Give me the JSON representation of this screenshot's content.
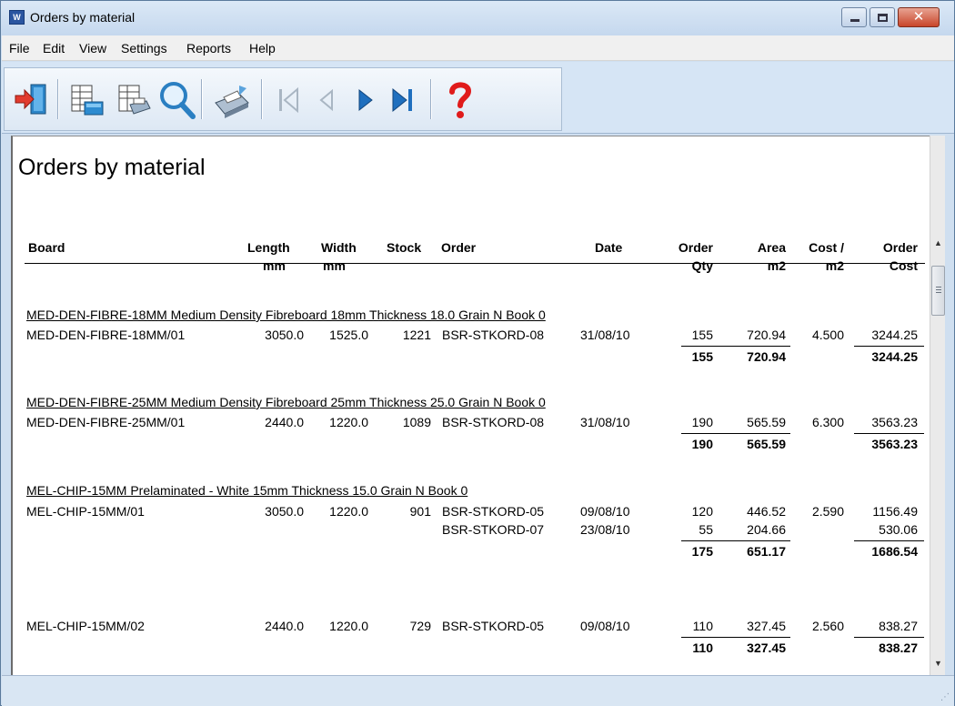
{
  "window": {
    "app_icon_text": "W",
    "title": "Orders by material",
    "close_glyph": "✕"
  },
  "menu": [
    "File",
    "Edit",
    "View",
    "Settings",
    "Reports",
    "Help"
  ],
  "toolbar": {
    "buttons": [
      "exit-icon",
      "board-list-icon",
      "print-list-icon",
      "search-icon",
      "printer-icon",
      "first-record-icon",
      "previous-record-icon",
      "next-record-icon",
      "last-record-icon",
      "help-icon"
    ]
  },
  "report": {
    "title": "Orders by material",
    "headers": {
      "board": "Board",
      "length": "Length",
      "length_unit": "mm",
      "width": "Width",
      "width_unit": "mm",
      "stock": "Stock",
      "order": "Order",
      "date": "Date",
      "order_qty_1": "Order",
      "order_qty_2": "Qty",
      "area_1": "Area",
      "area_2": "m2",
      "cost_1": "Cost /",
      "cost_2": "m2",
      "order_cost_1": "Order",
      "order_cost_2": "Cost"
    },
    "groups": [
      {
        "title": "MED-DEN-FIBRE-18MM Medium Density Fibreboard 18mm Thickness  18.0 Grain N Book 0",
        "rows": [
          {
            "board": "MED-DEN-FIBRE-18MM/01",
            "length": "3050.0",
            "width": "1525.0",
            "stock": "1221",
            "order": "BSR-STKORD-08",
            "date": "31/08/10",
            "qty": "155",
            "area": "720.94",
            "cost": "4.500",
            "order_cost": "3244.25"
          }
        ],
        "total": {
          "qty": "155",
          "area": "720.94",
          "order_cost": "3244.25"
        }
      },
      {
        "title": "MED-DEN-FIBRE-25MM Medium Density Fibreboard 25mm Thickness  25.0 Grain N Book 0",
        "rows": [
          {
            "board": "MED-DEN-FIBRE-25MM/01",
            "length": "2440.0",
            "width": "1220.0",
            "stock": "1089",
            "order": "BSR-STKORD-08",
            "date": "31/08/10",
            "qty": "190",
            "area": "565.59",
            "cost": "6.300",
            "order_cost": "3563.23"
          }
        ],
        "total": {
          "qty": "190",
          "area": "565.59",
          "order_cost": "3563.23"
        }
      },
      {
        "title": "MEL-CHIP-15MM Prelaminated - White 15mm Thickness  15.0 Grain N Book 0",
        "rows": [
          {
            "board": "MEL-CHIP-15MM/01",
            "length": "3050.0",
            "width": "1220.0",
            "stock": "901",
            "order": "BSR-STKORD-05",
            "date": "09/08/10",
            "qty": "120",
            "area": "446.52",
            "cost": "2.590",
            "order_cost": "1156.49"
          },
          {
            "board": "",
            "length": "",
            "width": "",
            "stock": "",
            "order": "BSR-STKORD-07",
            "date": "23/08/10",
            "qty": "55",
            "area": "204.66",
            "cost": "",
            "order_cost": "530.06"
          }
        ],
        "total": {
          "qty": "175",
          "area": "651.17",
          "order_cost": "1686.54"
        }
      },
      {
        "title": "",
        "rows": [
          {
            "board": "MEL-CHIP-15MM/02",
            "length": "2440.0",
            "width": "1220.0",
            "stock": "729",
            "order": "BSR-STKORD-05",
            "date": "09/08/10",
            "qty": "110",
            "area": "327.45",
            "cost": "2.560",
            "order_cost": "838.27"
          }
        ],
        "total": {
          "qty": "110",
          "area": "327.45",
          "order_cost": "838.27"
        }
      }
    ]
  },
  "scrollbar": {
    "up_arrow": "▲",
    "down_arrow": "▼"
  },
  "statusbar": {
    "text": "",
    "grip": "⋰"
  }
}
